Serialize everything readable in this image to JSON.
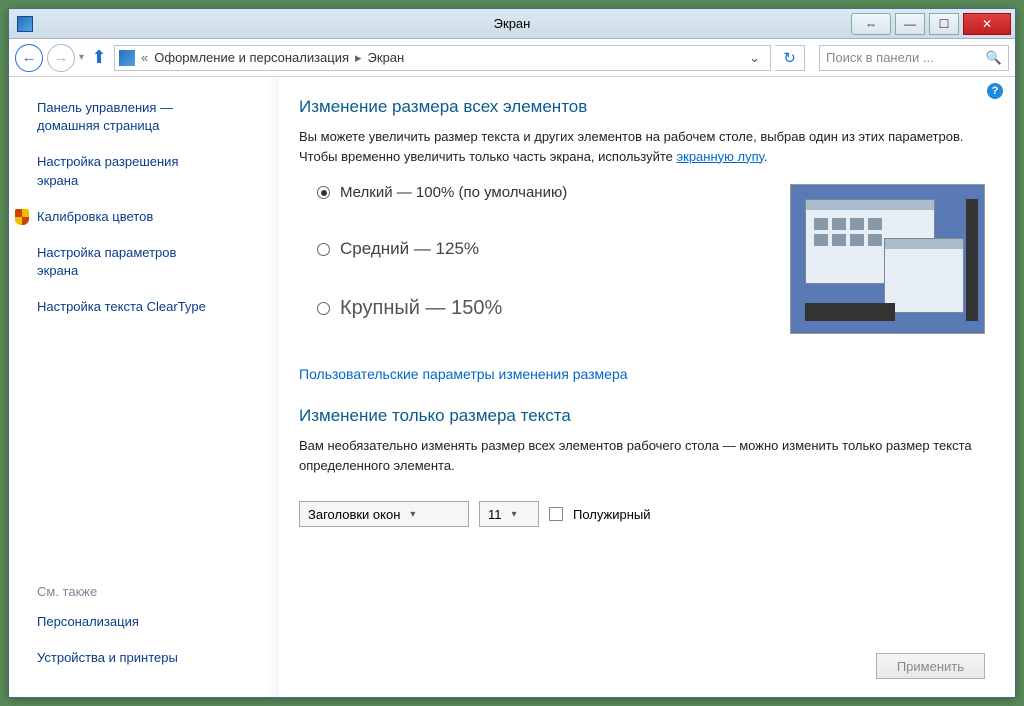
{
  "window": {
    "title": "Экран"
  },
  "breadcrumb": {
    "level1": "Оформление и персонализация",
    "level2": "Экран"
  },
  "search": {
    "placeholder": "Поиск в панели ..."
  },
  "sidebar": {
    "home1": "Панель управления —",
    "home2": "домашняя страница",
    "link_resolution1": "Настройка разрешения",
    "link_resolution2": "экрана",
    "link_calibrate": "Калибровка цветов",
    "link_params1": "Настройка параметров",
    "link_params2": "экрана",
    "link_cleartype": "Настройка текста ClearType",
    "see_also": "См. также",
    "link_personalize": "Персонализация",
    "link_devices": "Устройства и принтеры"
  },
  "main": {
    "heading1": "Изменение размера всех элементов",
    "desc1a": "Вы можете увеличить размер текста и других элементов на рабочем столе, выбрав один из этих параметров. Чтобы временно увеличить только часть экрана, используйте ",
    "desc1b": "экранную лупу",
    "desc1c": ".",
    "opt_small": "Мелкий — 100% (по умолчанию)",
    "opt_medium": "Средний — 125%",
    "opt_large": "Крупный — 150%",
    "link_custom": "Пользовательские параметры изменения размера",
    "heading2": "Изменение только размера текста",
    "desc2": "Вам необязательно изменять размер всех элементов рабочего стола — можно изменить только размер текста определенного элемента.",
    "combo_element": "Заголовки окон",
    "combo_size": "11",
    "check_bold": "Полужирный",
    "apply": "Применить"
  }
}
